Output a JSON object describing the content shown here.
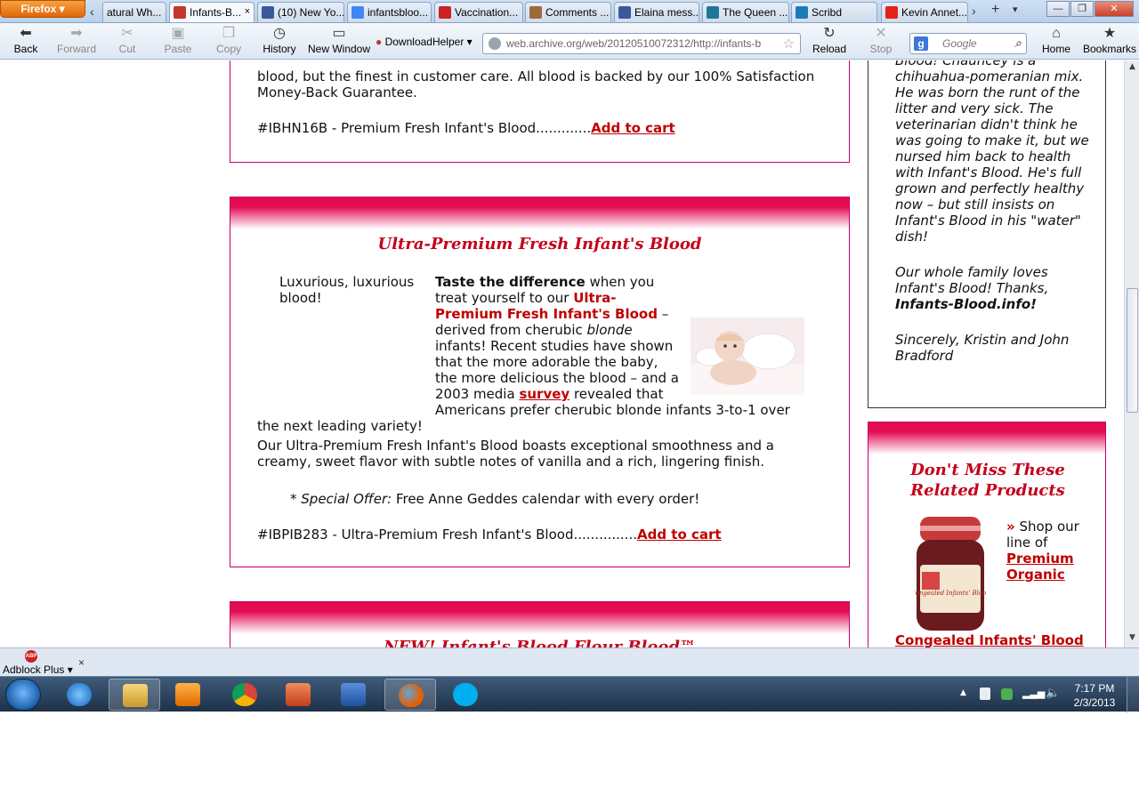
{
  "browser": {
    "app_button": "Firefox",
    "tabs": [
      {
        "label": "atural Wh...",
        "favicon_color": "#dddddd"
      },
      {
        "label": "Infants-B...",
        "favicon_color": "#c0392b",
        "active": true
      },
      {
        "label": "(10) New Yo...",
        "favicon_color": "#3b5998"
      },
      {
        "label": "infantsbloo...",
        "favicon_color": "#4285f4"
      },
      {
        "label": "Vaccination...",
        "favicon_color": "#cc2222"
      },
      {
        "label": "Comments ...",
        "favicon_color": "#9b6b3a"
      },
      {
        "label": "Elaina mess...",
        "favicon_color": "#3b5998"
      },
      {
        "label": "The Queen ...",
        "favicon_color": "#21759b"
      },
      {
        "label": "Scribd",
        "favicon_color": "#1a7bba"
      },
      {
        "label": "Kevin Annet...",
        "favicon_color": "#e62117"
      }
    ],
    "tab_close": "×",
    "tab_scroll_left": "‹",
    "tab_scroll_right": "›",
    "tab_new": "+",
    "tab_list": "▾",
    "window_controls": {
      "minimize": "—",
      "maximize": "❐",
      "close": "✕"
    },
    "toolbar": {
      "back": "Back",
      "forward": "Forward",
      "cut": "Cut",
      "paste": "Paste",
      "copy": "Copy",
      "history": "History",
      "new_window": "New Window",
      "downloadhelper": "DownloadHelper",
      "reload": "Reload",
      "stop": "Stop",
      "home": "Home",
      "bookmarks": "Bookmarks"
    },
    "url": "web.archive.org/web/20120510072312/http://infants-b",
    "search_placeholder": "Google"
  },
  "page": {
    "top_box": {
      "partial_line": "blood, but the finest in customer care. All blood is backed by our 100% Satisfaction",
      "line2": "Money-Back Guarantee.",
      "sku_line": "#IBHN16B - Premium Fresh Infant's Blood.............",
      "add_to_cart": "Add to cart"
    },
    "ultra_box": {
      "title": "Ultra-Premium Fresh Infant's Blood",
      "alt_text": "Luxurious, luxurious blood!",
      "taste_lead": "Taste the difference",
      "taste_rest1": " when you treat yourself to our ",
      "product_name": "Ultra-Premium Fresh Infant's Blood",
      "taste_rest2": " – derived from cherubic ",
      "blonde": "blonde",
      "taste_rest3": " infants! Recent studies have shown that the more adorable the baby, the more delicious the blood – and a 2003 media ",
      "survey": "survey",
      "taste_rest4": " revealed that Americans prefer cherubic blonde infants 3-to-1 over the next leading variety!",
      "para2": "Our Ultra-Premium Fresh Infant's Blood boasts exceptional smoothness and a creamy, sweet flavor with subtle notes of vanilla and a rich, lingering finish.",
      "special_prefix": "* ",
      "special_label": "Special Offer:",
      "special_text": " Free Anne Geddes calendar with every order!",
      "sku_line": "#IBPIB283 - Ultra-Premium Fresh Infant's Blood...............",
      "add_to_cart": "Add to cart"
    },
    "next_box": {
      "title_partial": "NEW! Infant's Blood Flour Blood™"
    },
    "testimonial": {
      "line1": "Blood! Chauncey is a chihuahua-pomeranian mix. He was born the runt of the litter and very sick. The veterinarian didn't think he was going to make it, but we nursed him back to health with Infant's Blood. He's full grown and perfectly healthy now – but still insists on Infant's Blood in his \"water\" dish!",
      "line2_pre": "Our whole family loves Infant's Blood! Thanks, ",
      "line2_site": "Infants-Blood.info!",
      "signoff": "Sincerely, Kristin and John Bradford"
    },
    "related": {
      "title": "Don't Miss These Related Products",
      "arrow": "»",
      "shop_text": " Shop our line of ",
      "link1": "Premium Organic",
      "link2": "Congealed Infants' Blood",
      "jar_label": "Congealed Infants' Blood"
    }
  },
  "addon_bar": {
    "label": "Adblock Plus",
    "icon_text": "ABP",
    "close": "×"
  },
  "taskbar": {
    "time": "7:17 PM",
    "date": "2/3/2013"
  }
}
